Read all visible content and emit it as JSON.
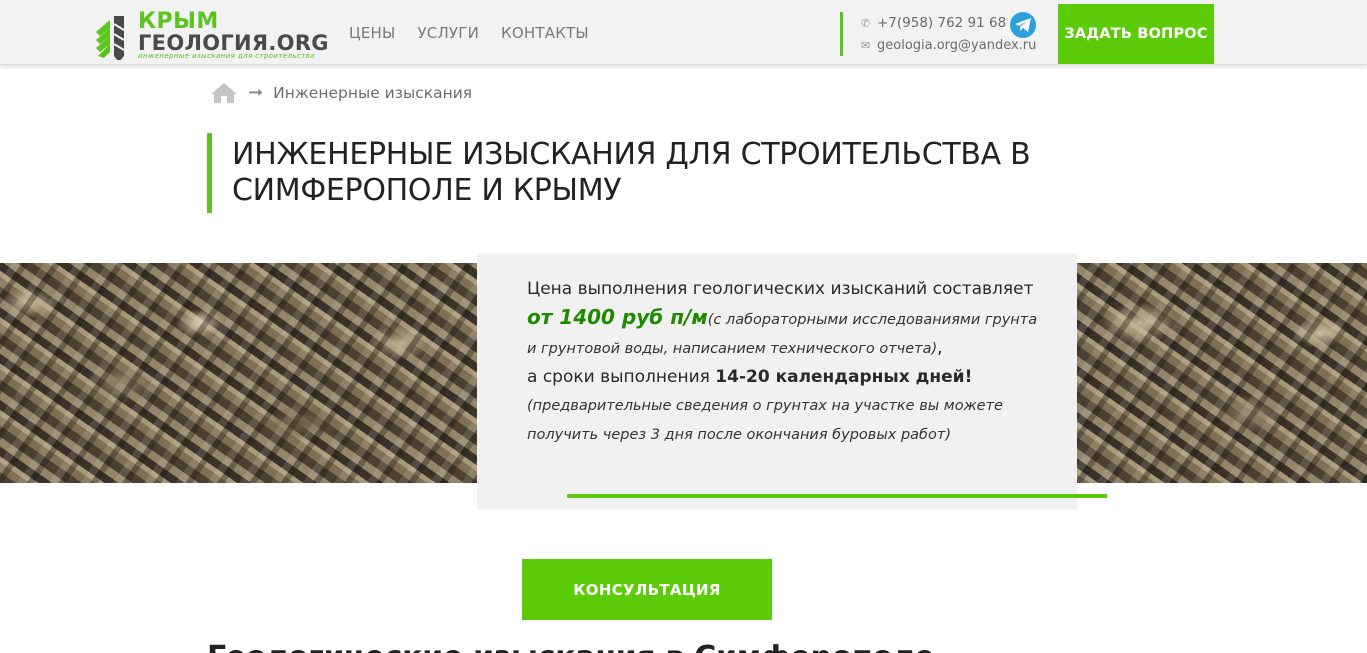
{
  "header": {
    "logo": {
      "line1": "КРЫМ",
      "line2": "ГЕОЛОГИЯ.ORG",
      "tagline": "инженерные изыскания для строительства"
    },
    "nav": [
      {
        "label": "ЦЕНЫ"
      },
      {
        "label": "УСЛУГИ"
      },
      {
        "label": "КОНТАКТЫ"
      }
    ],
    "phone": "+7(958) 762 91 68",
    "email": "geologia.org@yandex.ru",
    "ask_button": "ЗАДАТЬ ВОПРОС"
  },
  "breadcrumb": {
    "current": "Инженерные изыскания"
  },
  "page_title": "ИНЖЕНЕРНЫЕ ИЗЫСКАНИЯ ДЛЯ СТРОИТЕЛЬСТВА В СИМФЕРОПОЛЕ И КРЫМУ",
  "price_box": {
    "intro": "Цена выполнения геологических изысканий составляет ",
    "price": "от 1400 руб п/м",
    "price_note": "(с лабораторными исследованиями грунта и грунтовой воды, написанием технического отчета)",
    "terms_prefix": ",",
    "terms_intro": "а сроки выполнения ",
    "terms": "14-20 календарных дней!",
    "terms_note": "(предварительные сведения о грунтах на участке вы можете получить через 3 дня после окончания буровых работ)"
  },
  "consult_button": "КОНСУЛЬТАЦИЯ",
  "next_heading": "Геологические изыскания в Симферополе",
  "colors": {
    "accent": "#5ccc0a",
    "accent_dark": "#1f8a00",
    "telegram": "#2aa1dc"
  },
  "icons": [
    "logo-drill-icon",
    "phone-icon",
    "email-icon",
    "telegram-icon",
    "home-icon",
    "arrow-right-icon"
  ]
}
